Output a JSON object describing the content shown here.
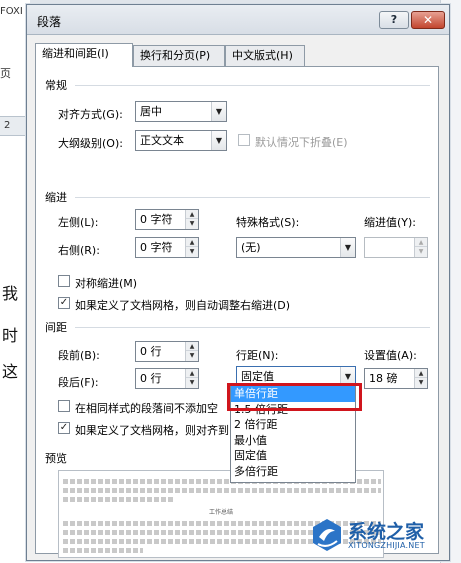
{
  "background": {
    "doc_text_top": "FOXI",
    "doc_text_side": "页",
    "doc_ruler_mark": "2",
    "doc_chars": [
      "时",
      "这"
    ],
    "doc_char_1": "我"
  },
  "dialog": {
    "title": "段落",
    "help_label": "?",
    "close_label": "✕",
    "tabs": [
      {
        "label": "缩进和间距(I)",
        "active": true
      },
      {
        "label": "换行和分页(P)",
        "active": false
      },
      {
        "label": "中文版式(H)",
        "active": false
      }
    ],
    "general": {
      "title": "常规",
      "alignment_label": "对齐方式(G):",
      "alignment_value": "居中",
      "outline_label": "大纲级别(O):",
      "outline_value": "正文文本",
      "collapse_label": "默认情况下折叠(E)"
    },
    "indent": {
      "title": "缩进",
      "left_label": "左侧(L):",
      "left_value": "0 字符",
      "right_label": "右侧(R):",
      "right_value": "0 字符",
      "special_label": "特殊格式(S):",
      "special_value": "(无)",
      "indent_value_label": "缩进值(Y):",
      "indent_value": "",
      "mirror_label": "对称缩进(M)",
      "auto_adjust_label": "如果定义了文档网格，则自动调整右缩进(D)"
    },
    "spacing": {
      "title": "间距",
      "before_label": "段前(B):",
      "before_value": "0 行",
      "after_label": "段后(F):",
      "after_value": "0 行",
      "line_spacing_label": "行距(N):",
      "line_spacing_value": "固定值",
      "setting_label": "设置值(A):",
      "setting_value": "18 磅",
      "no_space_label": "在相同样式的段落间不添加空",
      "snap_grid_label": "如果定义了文档网格，则对齐到",
      "dropdown_options": [
        "单倍行距",
        "1.5 倍行距",
        "2 倍行距",
        "最小值",
        "固定值",
        "多倍行距"
      ],
      "dropdown_selected": "单倍行距"
    },
    "preview": {
      "title": "预览",
      "sample_label": "工作总结"
    }
  },
  "watermark": {
    "text": "系统之家",
    "url": "XITONGZHIJIA.NET"
  },
  "colors": {
    "selection": "#3399ff",
    "highlight": "#d0151d",
    "close_button": "#c2452e",
    "watermark": "#1f5fa8"
  }
}
